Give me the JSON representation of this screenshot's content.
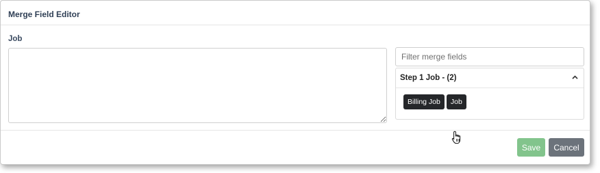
{
  "dialog": {
    "title": "Merge Field Editor"
  },
  "editor": {
    "label": "Job",
    "value": ""
  },
  "filter": {
    "placeholder": "Filter merge fields",
    "value": ""
  },
  "group": {
    "title": "Step 1 Job - (2)",
    "expanded": true,
    "fields": [
      {
        "label": "Billing Job"
      },
      {
        "label": "Job"
      }
    ]
  },
  "footer": {
    "save_label": "Save",
    "cancel_label": "Cancel"
  },
  "colors": {
    "save": "#82c48c",
    "cancel": "#6c737b",
    "chip": "#25272a"
  },
  "icons": {
    "collapse": "chevron-up-icon",
    "pointer": "hand-pointer-icon"
  }
}
